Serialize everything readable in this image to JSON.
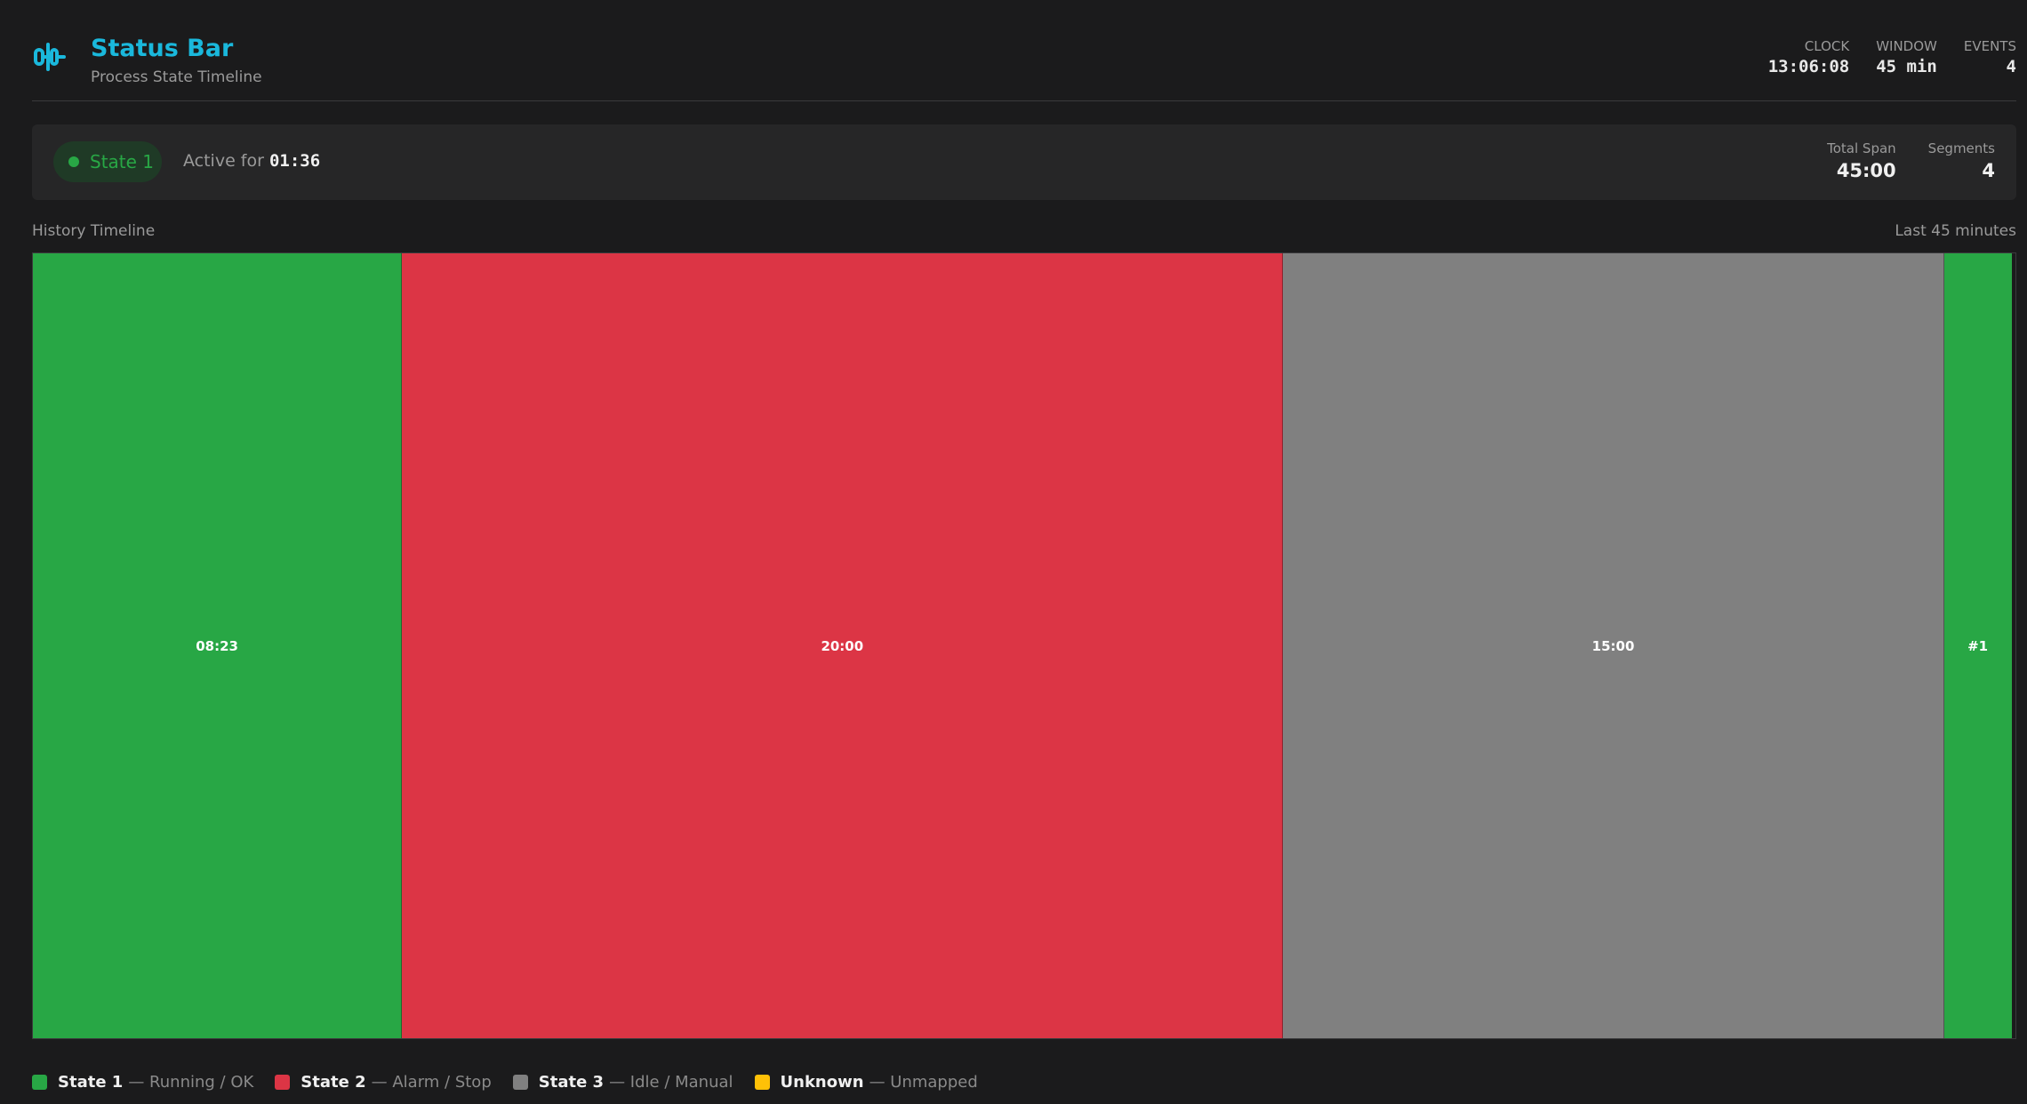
{
  "header": {
    "title": "Status Bar",
    "subtitle": "Process State Timeline",
    "icon": "signal-pulse-icon",
    "accent_color": "#1ab8dc",
    "stats": [
      {
        "label": "CLOCK",
        "value": "13:06:08"
      },
      {
        "label": "WINDOW",
        "value": "45 min"
      },
      {
        "label": "EVENTS",
        "value": "4"
      }
    ]
  },
  "current": {
    "state": "State 1",
    "active_prefix": "Active for",
    "active_time": "01:36",
    "total_span_label": "Total Span",
    "total_span_value": "45:00",
    "segments_label": "Segments",
    "segments_value": "4"
  },
  "timeline": {
    "label": "History Timeline",
    "range": "Last 45 minutes",
    "total_minutes": 45,
    "segments": [
      {
        "label": "08:23",
        "state": "State 1",
        "color": "#28a745",
        "minutes": 8.38
      },
      {
        "label": "20:00",
        "state": "State 2",
        "color": "#dc3545",
        "minutes": 20
      },
      {
        "label": "15:00",
        "state": "State 3",
        "color": "#808080",
        "minutes": 15
      },
      {
        "label": "#1",
        "state": "State 1",
        "color": "#28a745",
        "minutes": 1.53
      }
    ]
  },
  "legend": [
    {
      "name": "State 1",
      "desc": "— Running / OK",
      "color": "#28a745"
    },
    {
      "name": "State 2",
      "desc": "— Alarm / Stop",
      "color": "#dc3545"
    },
    {
      "name": "State 3",
      "desc": "— Idle / Manual",
      "color": "#808080"
    },
    {
      "name": "Unknown",
      "desc": "— Unmapped",
      "color": "#ffc107"
    }
  ]
}
